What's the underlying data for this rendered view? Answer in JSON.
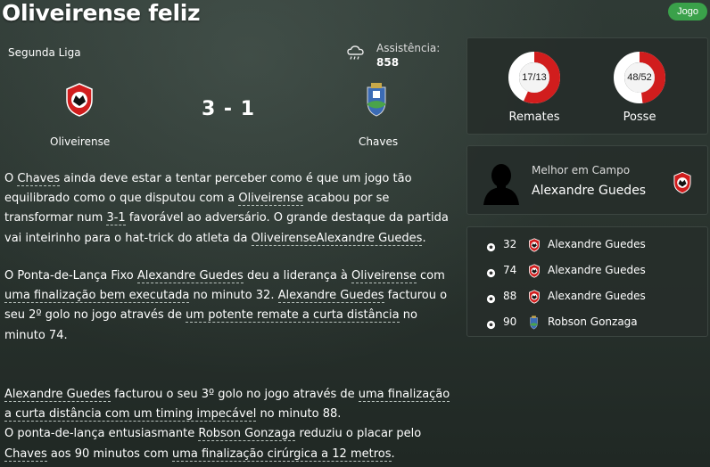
{
  "header": {
    "title": "Oliveirense feliz",
    "badge_label": "Jogo"
  },
  "match": {
    "league": "Segunda Liga",
    "weather_icon": "cloud-rain-icon",
    "attendance_label": "Assistência:",
    "attendance_value": "858",
    "home_team": "Oliveirense",
    "away_team": "Chaves",
    "score": "3 - 1"
  },
  "report": {
    "p1": [
      {
        "t": "O "
      },
      {
        "t": "Chaves",
        "link": true
      },
      {
        "t": " ainda deve estar a tentar perceber como é que um jogo tão equilibrado como o que disputou com a "
      },
      {
        "t": "Oliveirense",
        "link": true
      },
      {
        "t": " acabou por se transformar num "
      },
      {
        "t": "3-1",
        "link": true
      },
      {
        "t": " favorável ao adversário. O grande destaque da partida vai inteirinho para o hat-trick do atleta da "
      },
      {
        "t": "OliveirenseAlexandre Guedes",
        "link": true
      },
      {
        "t": "."
      }
    ],
    "p2": [
      {
        "t": "O Ponta-de-Lança Fixo "
      },
      {
        "t": "Alexandre Guedes",
        "link": true
      },
      {
        "t": " deu a liderança à "
      },
      {
        "t": "Oliveirense",
        "link": true
      },
      {
        "t": " com "
      },
      {
        "t": "uma finalização bem executada",
        "link": true
      },
      {
        "t": " no minuto 32. "
      },
      {
        "t": "Alexandre Guedes",
        "link": true
      },
      {
        "t": " facturou o seu 2º golo no jogo através de "
      },
      {
        "t": "um potente remate a curta distância",
        "link": true
      },
      {
        "t": " no minuto 74."
      }
    ],
    "p3": [
      {
        "t": "Alexandre Guedes",
        "link": true
      },
      {
        "t": " facturou o seu 3º golo no jogo através de "
      },
      {
        "t": "uma finalização a curta distância com um timing impecável",
        "link": true
      },
      {
        "t": " no minuto 88."
      }
    ],
    "p4": [
      {
        "t": "O ponta-de-lança entusiasmante "
      },
      {
        "t": "Robson Gonzaga",
        "link": true
      },
      {
        "t": " reduziu o placar pelo "
      },
      {
        "t": "Chaves",
        "link": true
      },
      {
        "t": " aos 90 minutos com "
      },
      {
        "t": "uma finalização cirúrgica a 12 metros",
        "link": true
      },
      {
        "t": "."
      }
    ]
  },
  "stats": {
    "shots": {
      "label": "Remates",
      "text": "17/13",
      "home_share": 0.567
    },
    "possession": {
      "label": "Posse",
      "text": "48/52",
      "home_share": 0.48
    }
  },
  "motm": {
    "title": "Melhor em Campo",
    "name": "Alexandre Guedes"
  },
  "goals": [
    {
      "minute": "32",
      "player": "Alexandre Guedes",
      "team": "home"
    },
    {
      "minute": "74",
      "player": "Alexandre Guedes",
      "team": "home"
    },
    {
      "minute": "88",
      "player": "Alexandre Guedes",
      "team": "home"
    },
    {
      "minute": "90",
      "player": "Robson Gonzaga",
      "team": "away"
    }
  ],
  "colors": {
    "home_primary": "#d11d1d",
    "away_primary": "#3b6bb5",
    "accent_green": "#3aa14a",
    "donut_empty": "#ffffff"
  }
}
